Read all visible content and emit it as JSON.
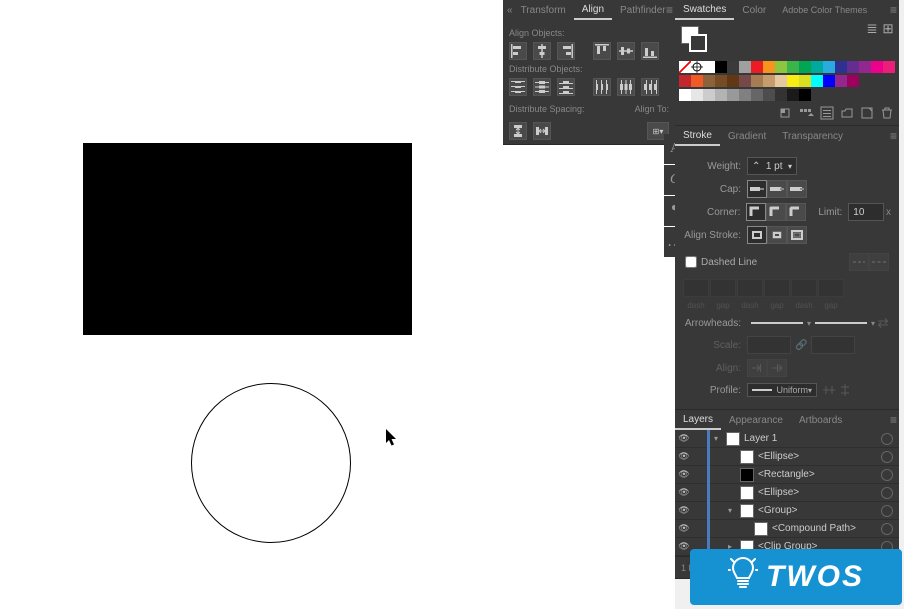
{
  "align_panel": {
    "tabs": [
      "Transform",
      "Align",
      "Pathfinder"
    ],
    "active_tab": "Align",
    "sections": {
      "align_objects": "Align Objects:",
      "distribute_objects": "Distribute Objects:",
      "distribute_spacing": "Distribute Spacing:",
      "align_to": "Align To:"
    }
  },
  "tool_strip": {
    "items": [
      "A",
      "O",
      "¶",
      "…"
    ]
  },
  "swatches_panel": {
    "tabs": [
      "Swatches",
      "Color",
      "Adobe Color Themes"
    ],
    "active_tab": "Swatches",
    "colors_row1": [
      "#ffffff",
      "#000000",
      "#3a3a3a",
      "#a0a0a0",
      "#ec1c24",
      "#f7941d",
      "#8cc63f",
      "#39b54a",
      "#00a651",
      "#00a99d",
      "#29abe2",
      "#2e3192",
      "#662d91",
      "#92278f",
      "#ec008c",
      "#ed1e79"
    ],
    "colors_row2": [
      "#c1272d",
      "#f15a24",
      "#8b6239",
      "#754c24",
      "#603813",
      "#754949",
      "#a67c52",
      "#c69c6d",
      "#e6c89e",
      "#f7ec13",
      "#d9e021",
      "#00ffff",
      "#0000ff",
      "#93268f",
      "#9e005d"
    ],
    "grays": [
      "#ffffff",
      "#e6e6e6",
      "#cccccc",
      "#b3b3b3",
      "#999999",
      "#808080",
      "#666666",
      "#4d4d4d",
      "#333333",
      "#1a1a1a",
      "#000000"
    ]
  },
  "stroke_panel": {
    "tabs": [
      "Stroke",
      "Gradient",
      "Transparency"
    ],
    "active_tab": "Stroke",
    "weight_label": "Weight:",
    "weight_value": "1 pt",
    "cap_label": "Cap:",
    "corner_label": "Corner:",
    "limit_label": "Limit:",
    "limit_value": "10",
    "align_stroke_label": "Align Stroke:",
    "dashed_line": "Dashed Line",
    "dash_labels": [
      "dash",
      "gap",
      "dash",
      "gap",
      "dash",
      "gap"
    ],
    "arrowheads_label": "Arrowheads:",
    "scale_label": "Scale:",
    "align_label": "Align:",
    "profile_label": "Profile:",
    "profile_value": "Uniform"
  },
  "layers_panel": {
    "tabs": [
      "Layers",
      "Appearance",
      "Artboards"
    ],
    "active_tab": "Layers",
    "items": [
      {
        "indent": 0,
        "name": "Layer 1",
        "expanded": true,
        "thumb": "#ffffff",
        "bar": "#4b7bbd",
        "toggle": "▾"
      },
      {
        "indent": 1,
        "name": "<Ellipse>",
        "thumb": "#ffffff",
        "bar": "#4b7bbd",
        "toggle": ""
      },
      {
        "indent": 1,
        "name": "<Rectangle>",
        "thumb": "#000000",
        "bar": "#4b7bbd",
        "toggle": ""
      },
      {
        "indent": 1,
        "name": "<Ellipse>",
        "thumb": "#ffffff",
        "bar": "#4b7bbd",
        "toggle": ""
      },
      {
        "indent": 1,
        "name": "<Group>",
        "expanded": true,
        "thumb": "#ffffff",
        "bar": "#4b7bbd",
        "toggle": "▾"
      },
      {
        "indent": 2,
        "name": "<Compound Path>",
        "thumb": "#ffffff",
        "bar": "#4b7bbd",
        "toggle": ""
      },
      {
        "indent": 1,
        "name": "<Clip Group>",
        "thumb": "#ffffff",
        "bar": "#4b7bbd",
        "toggle": "▸"
      }
    ],
    "footer": "1 Layer"
  },
  "badge": {
    "text": "TWOS"
  }
}
